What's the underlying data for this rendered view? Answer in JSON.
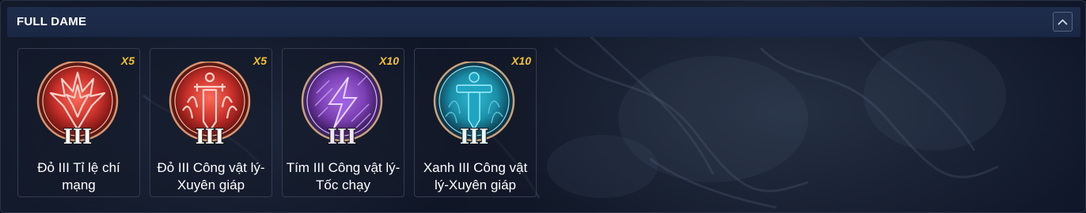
{
  "section": {
    "title": "FULL DAME",
    "collapse_icon": "chevron-up-icon"
  },
  "cards": [
    {
      "multiplier": "X5",
      "label": "Đỏ III Tỉ lệ chí mạng",
      "tier": "III",
      "color": "#c8302a",
      "icon": "red-crit-emblem-icon"
    },
    {
      "multiplier": "X5",
      "label": "Đỏ III Công vật lý-Xuyên giáp",
      "tier": "III",
      "color": "#c8302a",
      "icon": "red-sword-emblem-icon"
    },
    {
      "multiplier": "X10",
      "label": "Tím III Công vật lý-Tốc chạy",
      "tier": "III",
      "color": "#7b3fb4",
      "icon": "purple-lightning-emblem-icon"
    },
    {
      "multiplier": "X10",
      "label": "Xanh III Công vật lý-Xuyên giáp",
      "tier": "III",
      "color": "#1a8fa8",
      "icon": "cyan-sword-emblem-icon"
    }
  ]
}
